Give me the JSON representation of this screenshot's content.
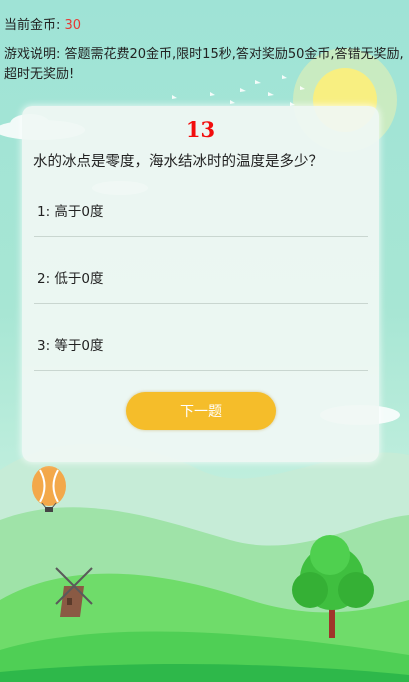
{
  "header": {
    "coins_label": "当前金币: ",
    "coins_value": "30",
    "rules": "游戏说明: 答题需花费20金币,限时15秒,答对奖励50金币,答错无奖励,超时无奖励!"
  },
  "quiz": {
    "countdown": "13",
    "question": "水的冰点是零度，海水结冰时的温度是多少？",
    "options": [
      {
        "label": "1: 高于0度"
      },
      {
        "label": "2: 低于0度"
      },
      {
        "label": "3: 等于0度"
      }
    ],
    "next_button": "下一题"
  },
  "colors": {
    "accent_button": "#f5bd2a",
    "countdown": "#f20d0d",
    "coins_value": "#e53935"
  }
}
